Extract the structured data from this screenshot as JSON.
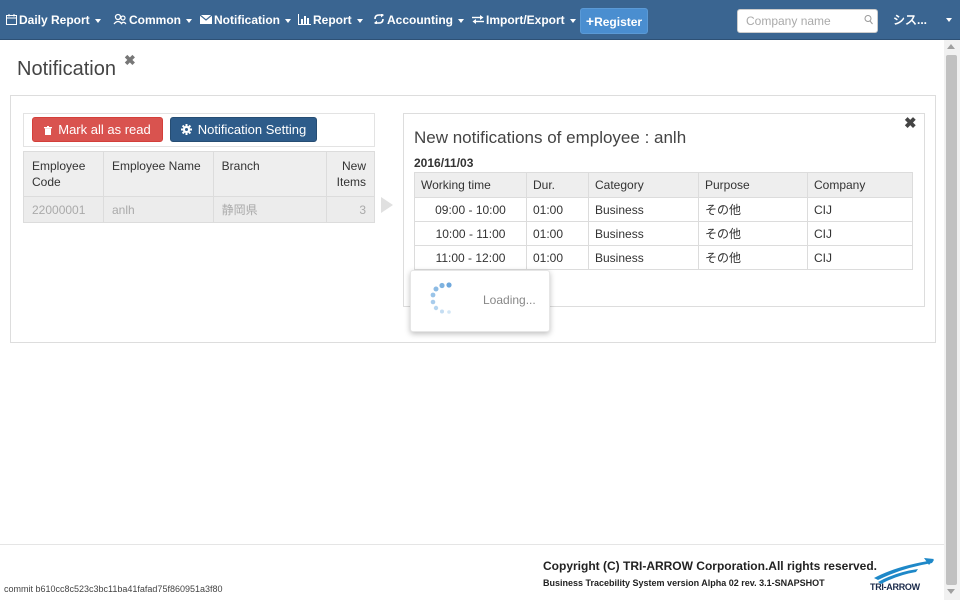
{
  "navbar": {
    "items": [
      {
        "label": "Daily Report",
        "icon": "calendar-icon"
      },
      {
        "label": "Common",
        "icon": "users-icon"
      },
      {
        "label": "Notification",
        "icon": "envelope-icon"
      },
      {
        "label": "Report",
        "icon": "bar-chart-icon"
      },
      {
        "label": "Accounting",
        "icon": "refresh-icon"
      },
      {
        "label": "Import/Export",
        "icon": "exchange-icon"
      }
    ],
    "register_label": "Register",
    "search_placeholder": "Company name",
    "user_label": "シス..."
  },
  "page": {
    "title": "Notification"
  },
  "actions": {
    "mark_all_read": "Mark all as read",
    "notification_setting": "Notification Setting"
  },
  "employee_table": {
    "headers": {
      "code": "Employee Code",
      "name": "Employee Name",
      "branch": "Branch",
      "new_items": "New Items"
    },
    "rows": [
      {
        "code": "22000001",
        "name": "anlh",
        "branch": "静岡県",
        "new_items": "3"
      }
    ]
  },
  "detail": {
    "title": "New notifications of employee : anlh",
    "date": "2016/11/03",
    "headers": {
      "working_time": "Working time",
      "duration": "Dur.",
      "category": "Category",
      "purpose": "Purpose",
      "company": "Company"
    },
    "rows": [
      {
        "working_time": "09:00 - 10:00",
        "duration": "01:00",
        "category": "Business",
        "purpose": "その他",
        "company": "CIJ"
      },
      {
        "working_time": "10:00 - 11:00",
        "duration": "01:00",
        "category": "Business",
        "purpose": "その他",
        "company": "CIJ"
      },
      {
        "working_time": "11:00 - 12:00",
        "duration": "01:00",
        "category": "Business",
        "purpose": "その他",
        "company": "CIJ"
      }
    ]
  },
  "loading": {
    "text": "Loading..."
  },
  "footer": {
    "copyright": "Copyright (C) TRI-ARROW Corporation.All rights reserved.",
    "version": "Business Tracebility System version Alpha 02 rev. 3.1-SNAPSHOT",
    "commit": "commit b610cc8c523c3bc11ba41fafad75f860951a3f80",
    "logo_text": "TRI-ARROW"
  },
  "colors": {
    "navbar": "#3a6591",
    "register": "#4a8ed0",
    "danger": "#d9534f",
    "primary_dark": "#2e5c8a"
  }
}
